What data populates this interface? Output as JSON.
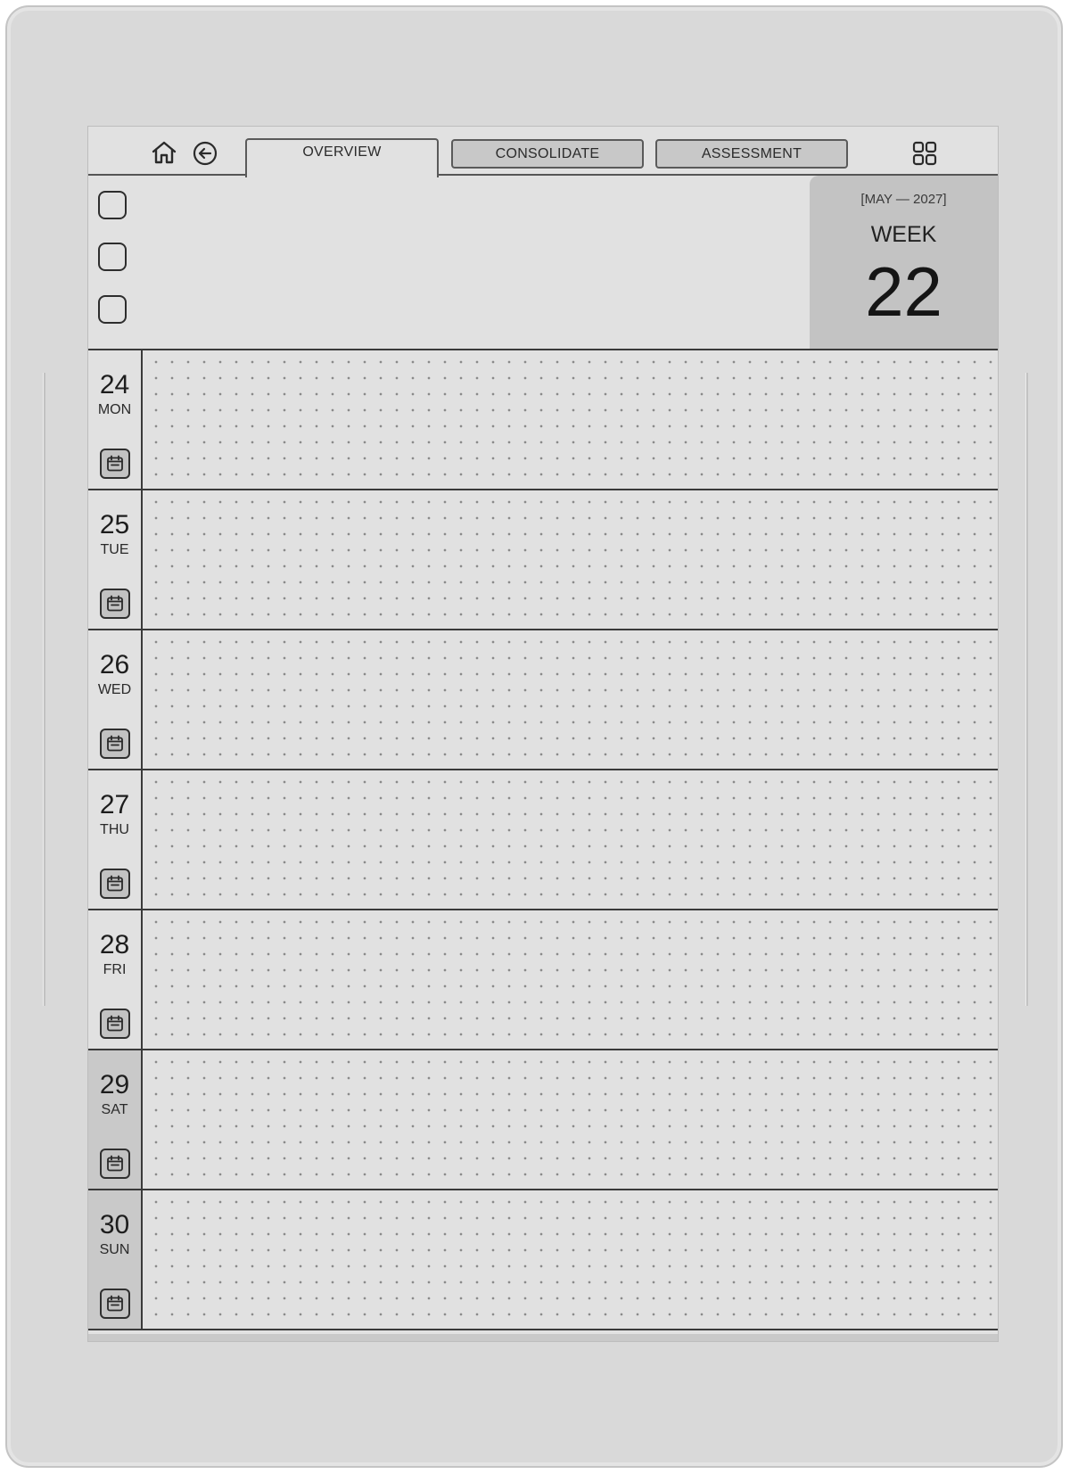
{
  "nav": {
    "tabs": [
      {
        "label": "OVERVIEW",
        "active": true
      },
      {
        "label": "CONSOLIDATE",
        "active": false
      },
      {
        "label": "ASSESSMENT",
        "active": false
      }
    ],
    "icons": [
      "home-icon",
      "back-arrow-icon",
      "grid-menu-icon"
    ]
  },
  "week": {
    "range": "[MAY — 2027]",
    "label": "WEEK",
    "number": "22"
  },
  "days": [
    {
      "num": "24",
      "name": "MON",
      "weekend": false
    },
    {
      "num": "25",
      "name": "TUE",
      "weekend": false
    },
    {
      "num": "26",
      "name": "WED",
      "weekend": false
    },
    {
      "num": "27",
      "name": "THU",
      "weekend": false
    },
    {
      "num": "28",
      "name": "FRI",
      "weekend": false
    },
    {
      "num": "29",
      "name": "SAT",
      "weekend": true
    },
    {
      "num": "30",
      "name": "SUN",
      "weekend": true
    }
  ],
  "colors": {
    "screen": "#e1e1e1",
    "accent_box": "#c3c3c3",
    "line": "#3a3a3a"
  }
}
